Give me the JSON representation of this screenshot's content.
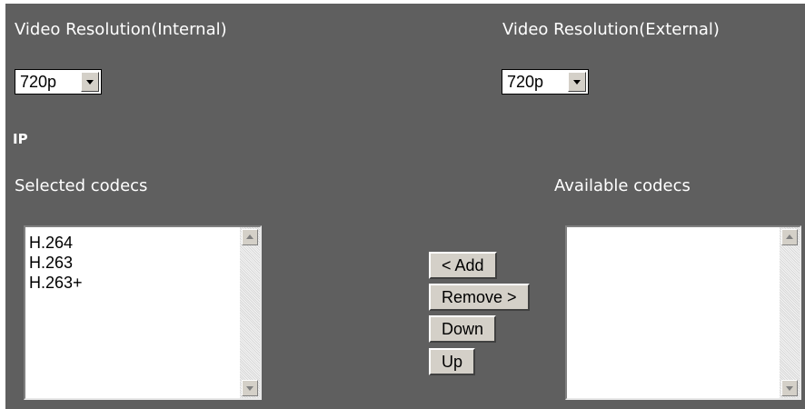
{
  "video": {
    "internal_label": "Video Resolution(Internal)",
    "internal_value": "720p",
    "external_label": "Video Resolution(External)",
    "external_value": "720p"
  },
  "ip": {
    "title": "IP"
  },
  "codecs": {
    "selected_label": "Selected codecs",
    "available_label": "Available codecs",
    "selected_items": [
      "H.264",
      "H.263",
      "H.263+"
    ],
    "available_items": []
  },
  "buttons": {
    "add": "< Add",
    "remove": "Remove >",
    "down": "Down",
    "up": "Up"
  },
  "colors": {
    "panel_background": "#5f5f5f",
    "text": "#ffffff",
    "button_face": "#d4d0c8"
  }
}
